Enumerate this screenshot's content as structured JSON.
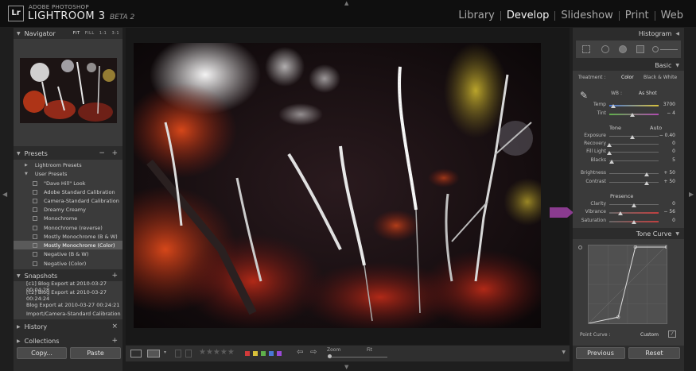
{
  "app": {
    "brand_small": "ADOBE PHOTOSHOP",
    "brand_name": "LIGHTROOM 3",
    "brand_beta": "BETA 2",
    "logo": "Lr"
  },
  "modules": [
    "Library",
    "Develop",
    "Slideshow",
    "Print",
    "Web"
  ],
  "active_module": "Develop",
  "navigator": {
    "title": "Navigator",
    "options": [
      "FIT",
      "FILL",
      "1:1",
      "3:1"
    ],
    "active_option": "FIT"
  },
  "presets": {
    "title": "Presets",
    "add": "+",
    "remove": "−",
    "items": [
      {
        "label": "Lightroom Presets",
        "type": "folder"
      },
      {
        "label": "User Presets",
        "type": "folder-open"
      },
      {
        "label": "\"Dave Hill\" Look",
        "type": "preset"
      },
      {
        "label": "Adobe Standard Calibration",
        "type": "preset"
      },
      {
        "label": "Camera-Standard Calibration",
        "type": "preset"
      },
      {
        "label": "Dreamy Creamy",
        "type": "preset"
      },
      {
        "label": "Monochrome",
        "type": "preset"
      },
      {
        "label": "Monochrome (reverse)",
        "type": "preset"
      },
      {
        "label": "Mostly Monochrome (B & W)",
        "type": "preset"
      },
      {
        "label": "Mostly Monochrome (Color)",
        "type": "preset",
        "selected": true
      },
      {
        "label": "Negative (B & W)",
        "type": "preset"
      },
      {
        "label": "Negative (Color)",
        "type": "preset"
      }
    ]
  },
  "snapshots": {
    "title": "Snapshots",
    "add": "+",
    "items": [
      "[c1] Blog Export at 2010-03-27 00:04:28",
      "[c2] Blog Export at 2010-03-27 00:24:24",
      "Blog Export at 2010-03-27 00:24:21",
      "Import/Camera-Standard Calibration"
    ]
  },
  "history": {
    "title": "History",
    "clear": "×"
  },
  "collections": {
    "title": "Collections",
    "add": "+"
  },
  "buttons": {
    "copy": "Copy...",
    "paste": "Paste",
    "previous": "Previous",
    "reset": "Reset"
  },
  "toolbar": {
    "zoom_label": "Zoom",
    "fit_label": "Fit",
    "zoom": 0,
    "stars": "★★★★★",
    "color_labels": [
      "#d23a3a",
      "#d8c13a",
      "#5fb04a",
      "#4a78d6",
      "#9a4ad6"
    ]
  },
  "histogram": {
    "title": "Histogram"
  },
  "basic": {
    "title": "Basic",
    "treatment_label": "Treatment :",
    "treatment_color": "Color",
    "treatment_bw": "Black & White",
    "wb_label": "WB :",
    "wb_value": "As Shot",
    "tone_label": "Tone",
    "tone_auto": "Auto",
    "presence_label": "Presence",
    "sliders": [
      {
        "name": "Temp",
        "value": "3700",
        "pos": 0.08
      },
      {
        "name": "Tint",
        "value": "− 4",
        "pos": 0.47
      },
      {
        "name": "Exposure",
        "value": "− 0.40",
        "pos": 0.46
      },
      {
        "name": "Recovery",
        "value": "0",
        "pos": 0.0
      },
      {
        "name": "Fill Light",
        "value": "0",
        "pos": 0.0
      },
      {
        "name": "Blacks",
        "value": "5",
        "pos": 0.05
      },
      {
        "name": "Brightness",
        "value": "+ 50",
        "pos": 0.75
      },
      {
        "name": "Contrast",
        "value": "+ 50",
        "pos": 0.75
      },
      {
        "name": "Clarity",
        "value": "0",
        "pos": 0.5
      },
      {
        "name": "Vibrance",
        "value": "− 56",
        "pos": 0.22
      },
      {
        "name": "Saturation",
        "value": "0",
        "pos": 0.5
      }
    ]
  },
  "tone_curve": {
    "title": "Tone Curve",
    "point_curve_label": "Point Curve :",
    "point_curve_value": "Custom"
  },
  "colors": {
    "accent_arrow": "#8a3b8f"
  }
}
